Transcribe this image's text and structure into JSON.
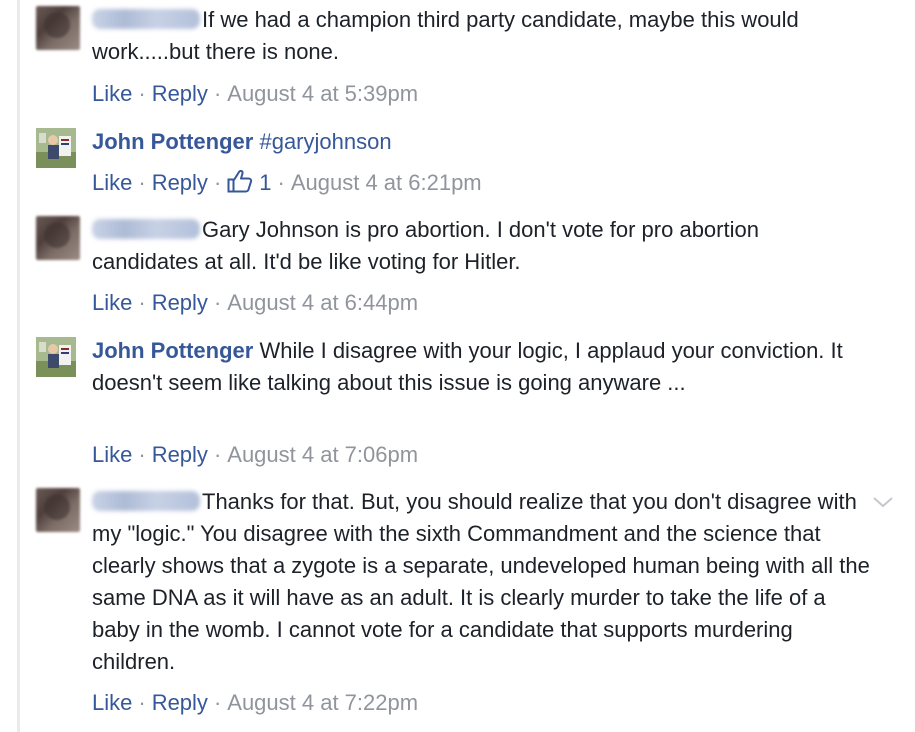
{
  "colors": {
    "link": "#365899",
    "meta": "#90949c",
    "text": "#1d2129"
  },
  "comments": [
    {
      "author": "",
      "author_redacted": true,
      "text": "If we had a champion third party candidate, maybe this would work.....but there is none.",
      "like_label": "Like",
      "reply_label": "Reply",
      "timestamp": "August 4 at 5:39pm"
    },
    {
      "author": "John Pottenger",
      "author_redacted": false,
      "text": "#garyjohnson",
      "like_label": "Like",
      "reply_label": "Reply",
      "like_count": "1",
      "timestamp": "August 4 at 6:21pm"
    },
    {
      "author": "",
      "author_redacted": true,
      "text": "Gary Johnson is pro abortion. I don't vote for pro abortion candidates at all. It'd be like voting for Hitler.",
      "like_label": "Like",
      "reply_label": "Reply",
      "timestamp": "August 4 at 6:44pm"
    },
    {
      "author": "John Pottenger",
      "author_redacted": false,
      "text": "While I disagree with your logic, I applaud your conviction. It doesn't seem like talking about this issue is going anyware ...",
      "like_label": "Like",
      "reply_label": "Reply",
      "timestamp": "August 4 at 7:06pm"
    },
    {
      "author": "",
      "author_redacted": true,
      "text": "Thanks for that. But, you should realize that you don't disagree with my \"logic.\" You disagree with the sixth Commandment and the science that clearly shows that a zygote is a separate, undeveloped human being with all the same DNA as it will have as an adult. It is clearly murder to take the life of a baby in the womb. I cannot vote for a candidate that supports murdering children.",
      "like_label": "Like",
      "reply_label": "Reply",
      "timestamp": "August 4 at 7:22pm"
    }
  ],
  "icons": {
    "thumb": "thumbs-up-icon",
    "chevron": "chevron-down-icon"
  }
}
